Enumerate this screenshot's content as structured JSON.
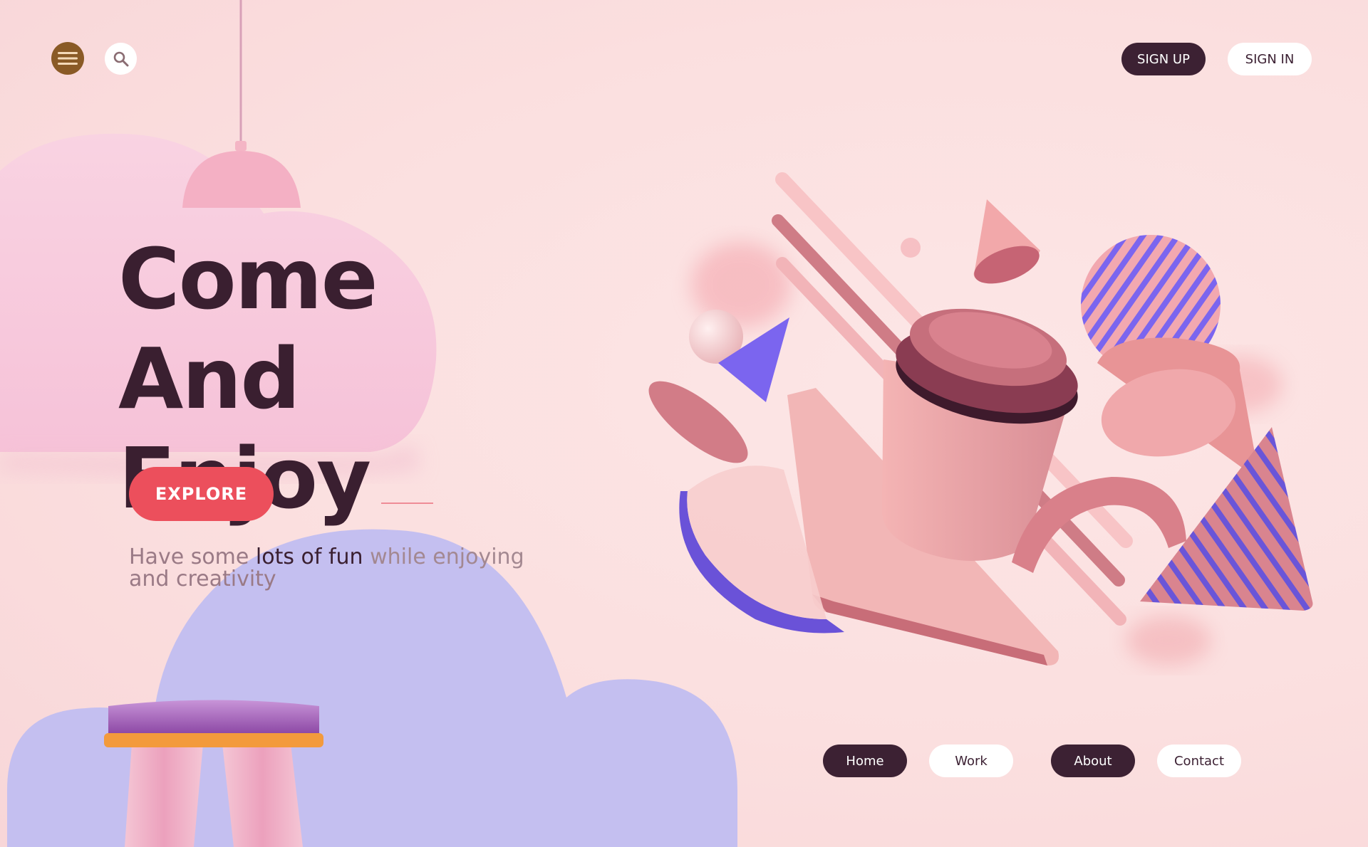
{
  "header": {
    "signup_label": "SIGN UP",
    "signin_label": "SIGN IN"
  },
  "hero": {
    "title_line1": "Come And",
    "title_line2": "Enjoy",
    "explore_label": "EXPLORE",
    "tagline_part1": "Have some ",
    "tagline_highlight": "lots of fun",
    "tagline_part2": " while enjoying",
    "tagline_part3": "and creativity"
  },
  "nav": {
    "items": [
      "Home",
      "Work",
      "About",
      "Contact"
    ]
  },
  "icons": {
    "menu": "hamburger-menu-icon",
    "search": "search-icon"
  },
  "colors": {
    "background": "#fbe1e1",
    "primary_dark": "#3c2133",
    "accent_red": "#ec4f5c",
    "menu_brown": "#8a5a26",
    "cloud_pink": "#f8c9dc",
    "cloud_lavender": "#c4bff0",
    "accent_purple": "#7b65ef"
  }
}
